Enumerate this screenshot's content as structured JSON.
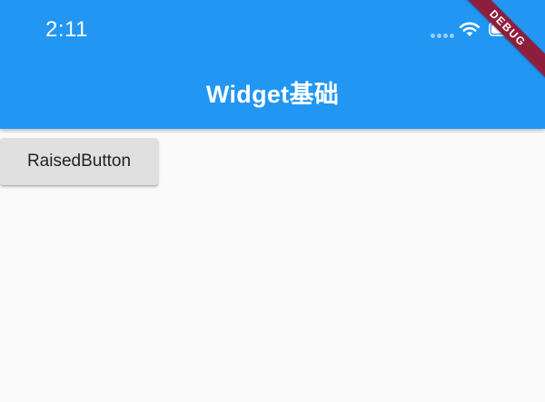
{
  "status_bar": {
    "time": "2:11",
    "icons": [
      "signal-dots-icon",
      "wifi-icon",
      "battery-icon"
    ]
  },
  "app_bar": {
    "title": "Widget基础",
    "color": "#2196f3"
  },
  "debug_banner": {
    "label": "DEBUG",
    "color": "#8e1f3c"
  },
  "content": {
    "raised_button_label": "RaisedButton",
    "button_color": "#e0e0e0",
    "background": "#fafafa"
  }
}
